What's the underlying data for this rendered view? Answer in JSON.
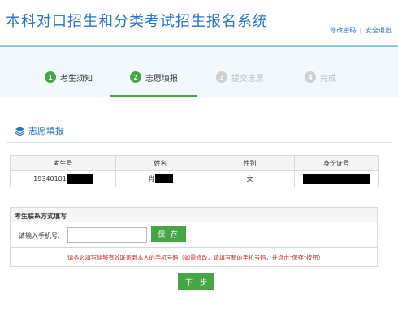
{
  "header": {
    "title": "本科对口招生和分类考试招生报名系统",
    "links": [
      "修改密码",
      "安全退出"
    ],
    "separator": "|"
  },
  "steps": [
    {
      "num": "1",
      "label": "考生须知",
      "state": "done"
    },
    {
      "num": "2",
      "label": "志愿填报",
      "state": "active"
    },
    {
      "num": "3",
      "label": "提交志愿",
      "state": "todo"
    },
    {
      "num": "4",
      "label": "完成",
      "state": "todo"
    }
  ],
  "section": {
    "title": "志愿填报",
    "icon": "layers-icon"
  },
  "info_table": {
    "headers": [
      "考生号",
      "姓名",
      "性别",
      "身份证号"
    ],
    "row": {
      "exam_no": "19340101",
      "name": "肖",
      "gender": "女",
      "id_no": ""
    }
  },
  "contact": {
    "title": "考生联系方式填写",
    "phone_label": "请输入手机号:",
    "phone_value": "",
    "phone_placeholder": "",
    "save_label": "保 存",
    "notice": "请务必填写能够有效联系到本人的手机号码（如需修改，请填写新的手机号码，并点击\"保存\"按钮）"
  },
  "next_label": "下一步",
  "colors": {
    "brand_blue": "#2a74c4",
    "green": "#47a447",
    "warning_red": "#d9232d"
  }
}
